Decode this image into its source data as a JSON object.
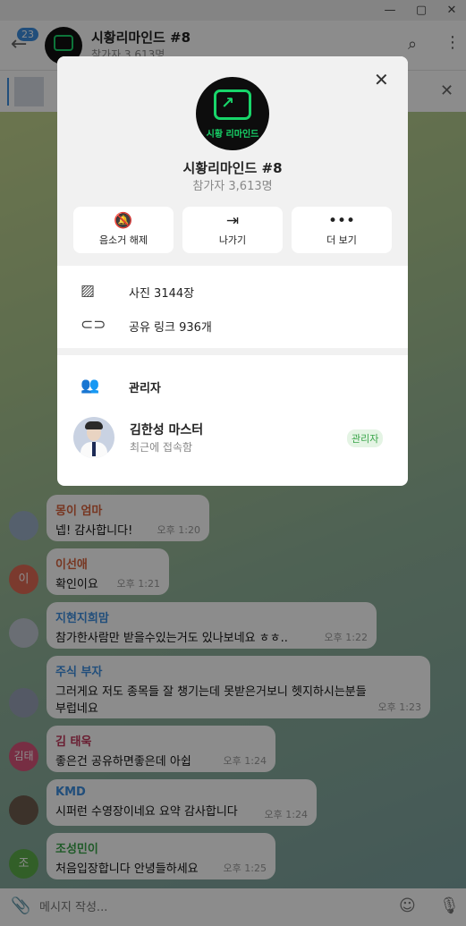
{
  "window": {
    "minimize": "—",
    "maximize": "▢",
    "close": "✕"
  },
  "header": {
    "unread_count": "23",
    "title": "시황리마인드 #8",
    "subtitle": "참가자 3,613명"
  },
  "input": {
    "placeholder": "메시지 작성..."
  },
  "messages": [
    {
      "sender": "몽이 엄마",
      "sender_color": "#d9633d",
      "avatar_color": "#9bb0c6",
      "avatar_text": "",
      "text": "넵! 감사합니다!",
      "time": "오후 1:20"
    },
    {
      "sender": "이선애",
      "sender_color": "#d9633d",
      "avatar_color": "#e06a54",
      "avatar_text": "이",
      "text": "확인이요",
      "time": "오후 1:21"
    },
    {
      "sender": "지현지희맘",
      "sender_color": "#3d8ee0",
      "avatar_color": "#c2c9d4",
      "avatar_text": "",
      "text": "참가한사람만 받을수있는거도 있나보네요 ㅎㅎ..",
      "time": "오후 1:22"
    },
    {
      "sender": "주식 부자",
      "sender_color": "#3d8ee0",
      "avatar_color": "#9aa3b8",
      "avatar_text": "",
      "text": "그러게요 저도 종목들 잘 챙기는데 못받은거보니 헷지하시는분들",
      "text2": "부럽네요",
      "time": "오후 1:23"
    },
    {
      "sender": "김 태욱",
      "sender_color": "#c0365a",
      "avatar_color": "#d9557a",
      "avatar_text": "김태",
      "text": "좋은건 공유하면좋은데 아쉽",
      "time": "오후 1:24"
    },
    {
      "sender": "KMD",
      "sender_color": "#3d8ee0",
      "avatar_color": "#6d5c4e",
      "avatar_text": "",
      "text": "시퍼런 수영장이네요 요약 감사합니다",
      "time": "오후 1:24"
    },
    {
      "sender": "조성민이",
      "sender_color": "#3aa54a",
      "avatar_color": "#5cae4a",
      "avatar_text": "조",
      "text": "처음입장합니다 안녕들하세요",
      "time": "오후 1:25"
    }
  ],
  "modal": {
    "brand_text": "시황 리마인드",
    "title": "시황리마인드 #8",
    "subtitle": "참가자 3,613명",
    "actions": [
      {
        "label": "음소거 해제",
        "icon": "bell-off-icon"
      },
      {
        "label": "나가기",
        "icon": "leave-icon"
      },
      {
        "label": "더 보기",
        "icon": "more-icon"
      }
    ],
    "media": [
      {
        "label": "사진 3144장",
        "icon": "photo-icon"
      },
      {
        "label": "공유 링크 936개",
        "icon": "link-icon"
      }
    ],
    "admins_heading": "관리자",
    "admin": {
      "name": "김한성 마스터",
      "status": "최근에 접속함",
      "badge": "관리자"
    }
  }
}
